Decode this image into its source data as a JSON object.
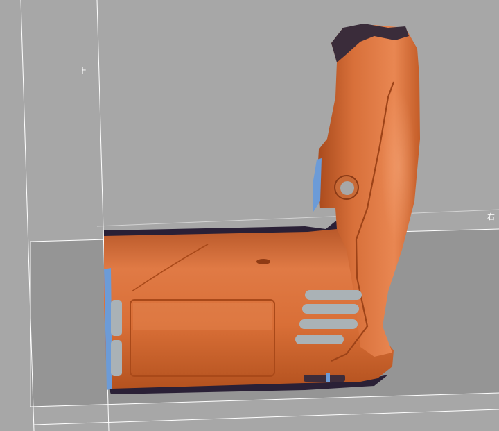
{
  "viewport": {
    "background": "#a7a7a7",
    "floor_plane_color": "#959595",
    "bounding_box_line_color": "#ffffff"
  },
  "axis_labels": {
    "up": "上",
    "right": "右"
  },
  "model": {
    "icon": "power-drill-housing-scan",
    "colors": {
      "surface": "#d4682c",
      "highlight": "#ea8450",
      "shadow": "#2a2036",
      "backface": "#6c9bd7",
      "vent_slots": "#aab2b6"
    }
  }
}
